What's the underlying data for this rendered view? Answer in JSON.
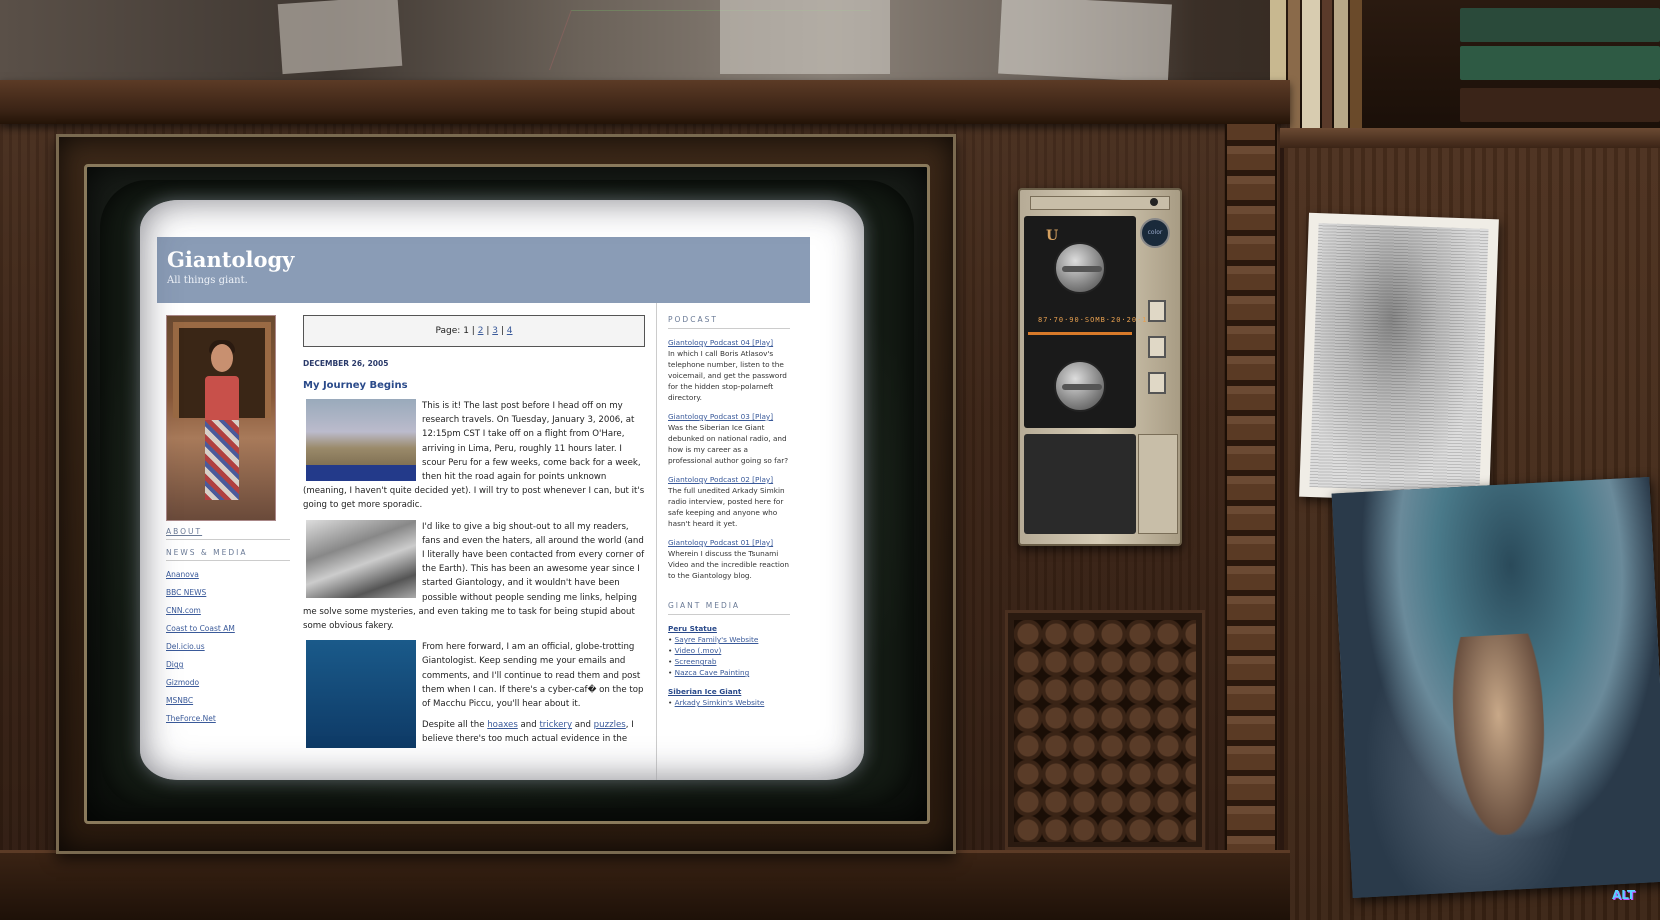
{
  "site": {
    "title": "Giantology",
    "tagline": "All things giant."
  },
  "left_sidebar": {
    "about_label": "ABOUT",
    "news_media_label": "NEWS & MEDIA",
    "links": [
      "Ananova",
      "BBC NEWS",
      "CNN.com",
      "Coast to Coast AM",
      "Del.icio.us",
      "Digg",
      "Gizmodo",
      "MSNBC",
      "TheForce.Net"
    ]
  },
  "pager": {
    "prefix": "Page:",
    "current": "1",
    "sep": "|",
    "pages": [
      "2",
      "3",
      "4"
    ]
  },
  "post": {
    "date": "DECEMBER 26, 2005",
    "title": "My Journey Begins",
    "p1": "This is it! The last post before I head off on my research travels. On Tuesday, January 3, 2006, at 12:15pm CST I take off on a flight from O'Hare, arriving in Lima, Peru, roughly 11 hours later. I scour Peru for a few weeks, come back for a week, then hit the road again for points unknown (meaning, I haven't quite decided yet). I will try to post whenever I can, but it's going to get more sporadic.",
    "p2": "I'd like to give a big shout-out to all my readers, fans and even the haters, all around the world (and I literally have been contacted from every corner of the Earth). This has been an awesome year since I started Giantology, and it wouldn't have been possible without people sending me links, helping me solve some mysteries, and even taking me to task for being stupid about some obvious fakery.",
    "p3": "From here forward, I am an official, globe-trotting Giantologist. Keep sending me your emails and comments, and I'll continue to read them and post them when I can. If there's a cyber-caf� on the top of Macchu Piccu, you'll hear about it.",
    "p4_start": "Despite all the",
    "p4_link1": "hoaxes",
    "p4_and1": "and",
    "p4_link2": "trickery",
    "p4_and2": "and",
    "p4_link3": "puzzles",
    "p4_end": ", I believe there's too much actual evidence in the"
  },
  "right_sidebar": {
    "podcast_heading": "PODCAST",
    "podcasts": [
      {
        "link": "Giantology Podcast 04 [Play]",
        "desc": "In which I call Boris Atlasov's telephone number, listen to the voicemail, and get the password for the hidden stop-polarneft directory."
      },
      {
        "link": "Giantology Podcast 03 [Play]",
        "desc": "Was the Siberian Ice Giant debunked on national radio, and how is my career as a professional author going so far?"
      },
      {
        "link": "Giantology Podcast 02 [Play]",
        "desc": "The full unedited Arkady Simkin radio interview, posted here for safe keeping and anyone who hasn't heard it yet."
      },
      {
        "link": "Giantology Podcast 01 [Play]",
        "desc": "Wherein I discuss the Tsunami Video and the incredible reaction to the Giantology blog."
      }
    ],
    "giant_media_heading": "GIANT MEDIA",
    "groups": [
      {
        "title": "Peru Statue",
        "items": [
          "Sayre Family's Website",
          "Video (.mov)",
          "Screengrab",
          "Nazca Cave Painting"
        ]
      },
      {
        "title": "Siberian Ice Giant",
        "items": [
          "Arkady Simkin's Website"
        ]
      }
    ]
  },
  "radio": {
    "u_mark": "U",
    "freq_text": "87·70·90·SOMB·20·20·14",
    "badge": "color"
  },
  "logo": "ALT"
}
